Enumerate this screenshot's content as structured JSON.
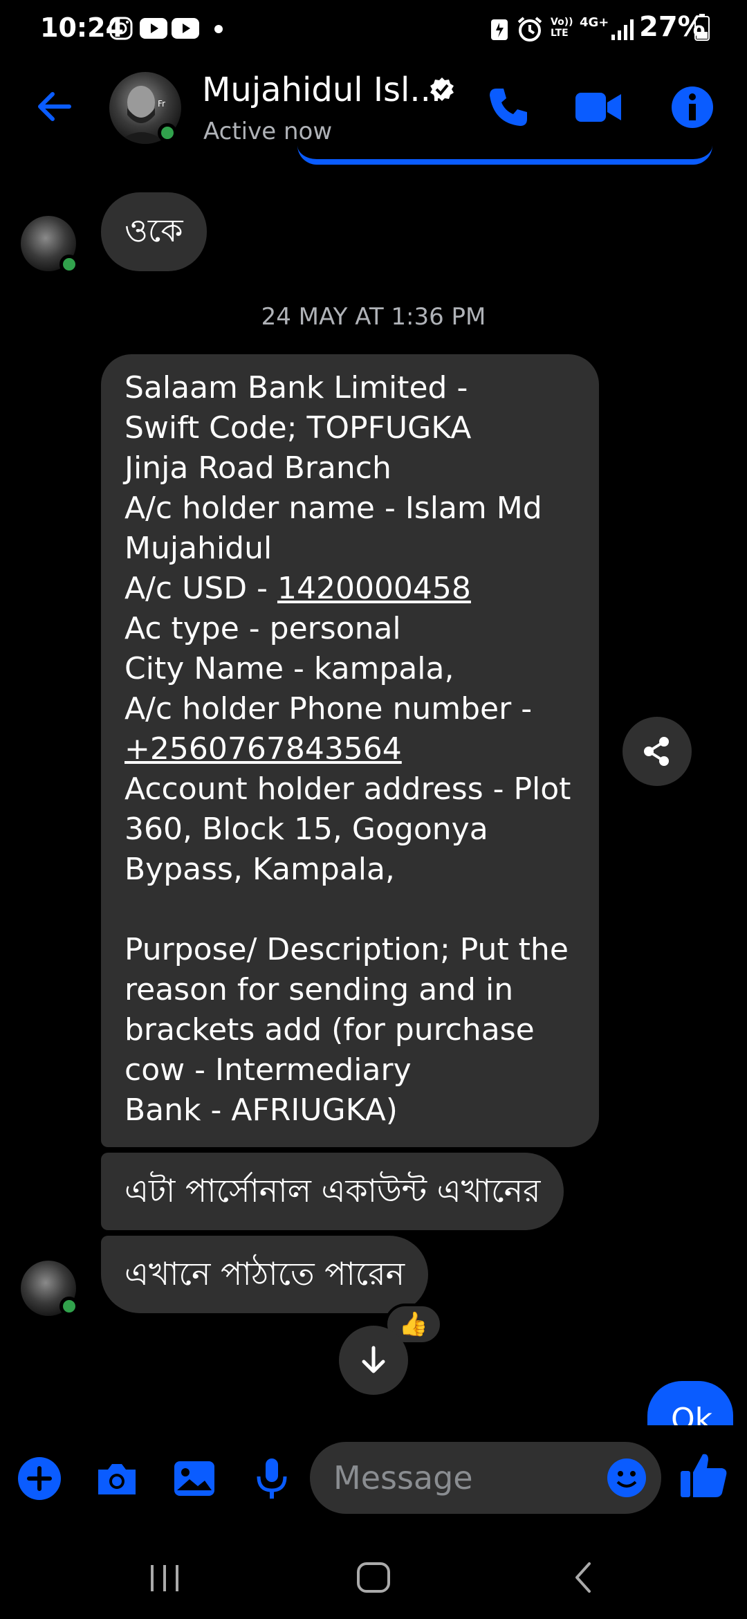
{
  "status_bar": {
    "time": "10:24",
    "battery": "27%",
    "network_label": "4G+",
    "volte_label": "Vo)) LTE"
  },
  "header": {
    "contact_name": "Mujahidul Isl...",
    "active_status": "Active now"
  },
  "messages": {
    "first": "ওকে",
    "timestamp": "24 MAY AT 1:36 PM",
    "bank_details": {
      "line1": "Salaam Bank Limited  -",
      "line2": "Swift Code; TOPFUGKA",
      "line3": "Jinja Road Branch",
      "line4": "A/c holder name - Islam Md",
      "line5": "Mujahidul",
      "line6_prefix": "A/c USD - ",
      "line6_account": "1420000458",
      "line7": "Ac type - personal",
      "line8": "City Name - kampala,",
      "line9": "A/c holder Phone number -",
      "line10_phone": "+2560767843564",
      "line11": "Account holder address - Plot",
      "line12": "360, Block 15, Gogonya",
      "line13": "Bypass, Kampala,",
      "line14": "Purpose/ Description; Put the",
      "line15": "reason for sending and in",
      "line16": "brackets add (for purchase",
      "line17": "cow - Intermediary",
      "line18": "Bank - AFRIUGKA)"
    },
    "personal_account": "এটা পার্সোনাল একাউন্ট এখানের",
    "send_here": "এখানে পাঠাতে পারেন",
    "reaction": "👍",
    "reply": "Ok"
  },
  "composer": {
    "placeholder": "Message"
  },
  "colors": {
    "accent": "#0a5cff",
    "bubble": "#303030",
    "online": "#31a24c",
    "muted": "#b0b3b8"
  },
  "icons": [
    "back-arrow-icon",
    "verified-icon",
    "phone-icon",
    "video-icon",
    "info-icon",
    "share-icon",
    "arrow-down-icon",
    "plus-icon",
    "camera-icon",
    "gallery-icon",
    "microphone-icon",
    "emoji-icon",
    "like-icon",
    "recents-icon",
    "home-icon",
    "back-icon"
  ]
}
